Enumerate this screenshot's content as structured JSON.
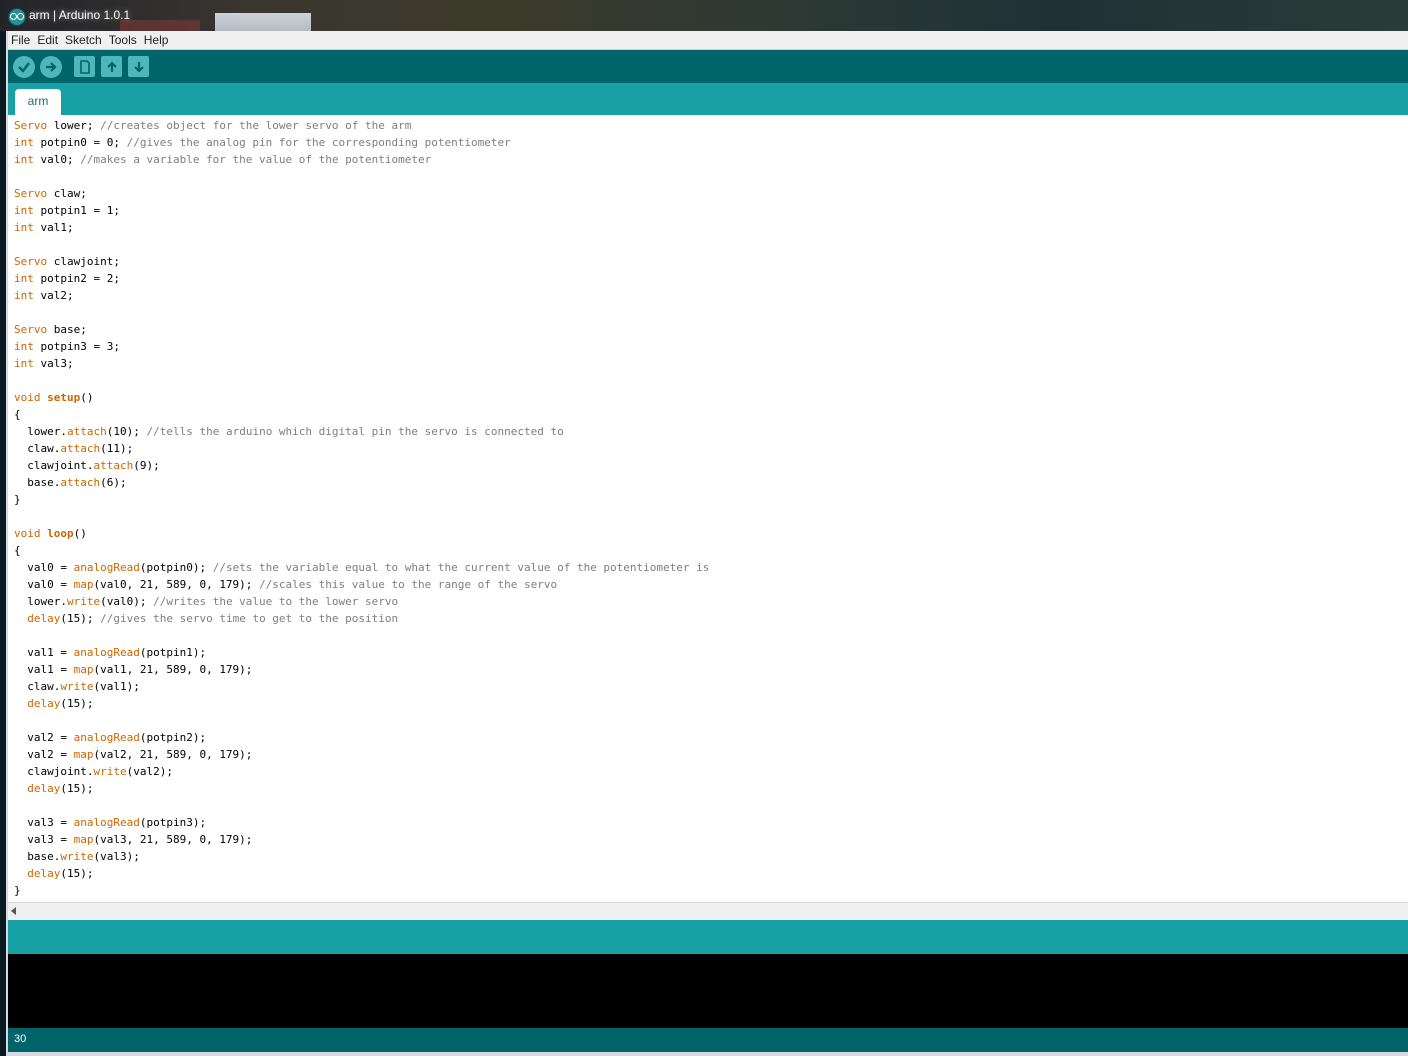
{
  "window": {
    "title": "arm | Arduino 1.0.1"
  },
  "menu": [
    "File",
    "Edit",
    "Sketch",
    "Tools",
    "Help"
  ],
  "toolbar": {
    "buttons": [
      {
        "name": "verify",
        "icon": "checkmark-icon"
      },
      {
        "name": "upload",
        "icon": "arrow-right-icon"
      },
      {
        "name": "new",
        "icon": "new-document-icon"
      },
      {
        "name": "open",
        "icon": "arrow-up-icon"
      },
      {
        "name": "save",
        "icon": "arrow-down-icon"
      }
    ]
  },
  "tabs": [
    {
      "label": "arm"
    }
  ],
  "code_lines": [
    "Servo lower; //creates object for the lower servo of the arm",
    "int potpin0 = 0; //gives the analog pin for the corresponding potentiometer",
    "int val0; //makes a variable for the value of the potentiometer",
    "",
    "Servo claw;",
    "int potpin1 = 1;",
    "int val1;",
    "",
    "Servo clawjoint;",
    "int potpin2 = 2;",
    "int val2;",
    "",
    "Servo base;",
    "int potpin3 = 3;",
    "int val3;",
    "",
    "void setup()",
    "{",
    "  lower.attach(10); //tells the arduino which digital pin the servo is connected to",
    "  claw.attach(11);",
    "  clawjoint.attach(9);",
    "  base.attach(6);",
    "}",
    "",
    "void loop()",
    "{",
    "  val0 = analogRead(potpin0); //sets the variable equal to what the current value of the potentiometer is",
    "  val0 = map(val0, 21, 589, 0, 179); //scales this value to the range of the servo",
    "  lower.write(val0); //writes the value to the lower servo",
    "  delay(15); //gives the servo time to get to the position",
    "",
    "  val1 = analogRead(potpin1);",
    "  val1 = map(val1, 21, 589, 0, 179);",
    "  claw.write(val1);",
    "  delay(15);",
    "",
    "  val2 = analogRead(potpin2);",
    "  val2 = map(val2, 21, 589, 0, 179);",
    "  clawjoint.write(val2);",
    "  delay(15);",
    "",
    "  val3 = analogRead(potpin3);",
    "  val3 = map(val3, 21, 589, 0, 179);",
    "  base.write(val3);",
    "  delay(15);",
    "}"
  ],
  "status": {
    "line_number": "30"
  },
  "colors": {
    "toolbar": "#006468",
    "tabstrip": "#17a1a5",
    "keyword": "#cc6600",
    "comment": "#7e7e7e"
  }
}
